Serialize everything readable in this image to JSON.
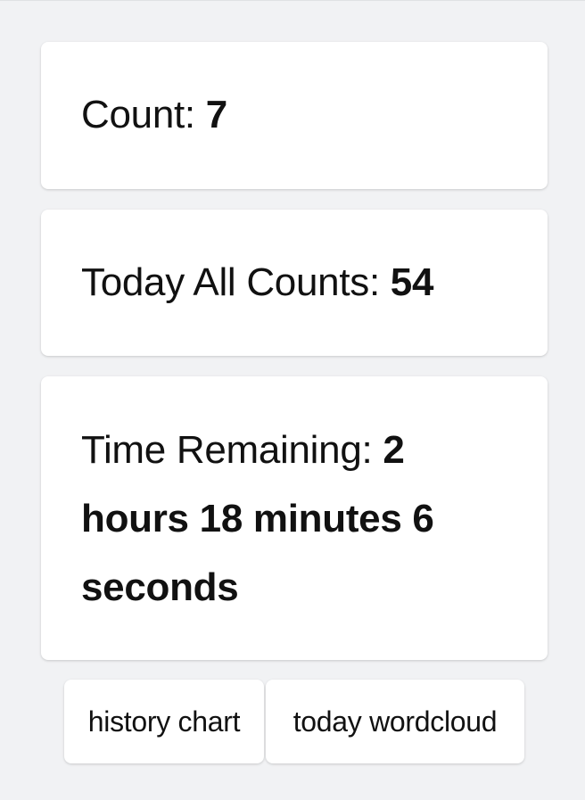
{
  "stats": {
    "count_label": "Count: ",
    "count_value": "7",
    "today_label": "Today All Counts: ",
    "today_value": "54",
    "time_label": "Time Remaining: ",
    "time_value": "2 hours 18 minutes 6 seconds"
  },
  "buttons": {
    "history_label": "history chart",
    "wordcloud_label": "today wordcloud"
  }
}
